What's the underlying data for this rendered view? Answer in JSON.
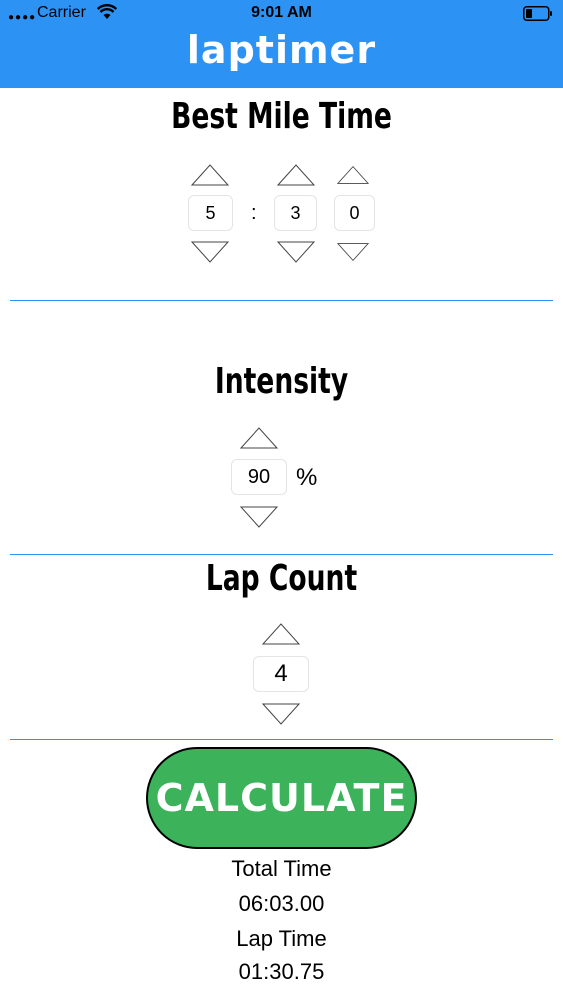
{
  "status_bar": {
    "carrier": "Carrier",
    "time": "9:01 AM",
    "icons": [
      "signal-dots-icon",
      "wifi-icon",
      "battery-icon"
    ]
  },
  "header": {
    "title": "laptimer",
    "color": "#2c93f5"
  },
  "best_mile_time": {
    "title": "Best Mile Time",
    "minutes": "5",
    "separator": ":",
    "seconds_tens": "3",
    "seconds_ones": "0"
  },
  "intensity": {
    "title": "Intensity",
    "value": "90",
    "unit": "%"
  },
  "lap_count": {
    "title": "Lap Count",
    "value": "4"
  },
  "calculate": {
    "label": "CALCULATE",
    "color": "#3cb25a"
  },
  "results": {
    "total_label": "Total Time",
    "total_value": "06:03.00",
    "lap_label": "Lap Time",
    "lap_value": "01:30.75"
  }
}
